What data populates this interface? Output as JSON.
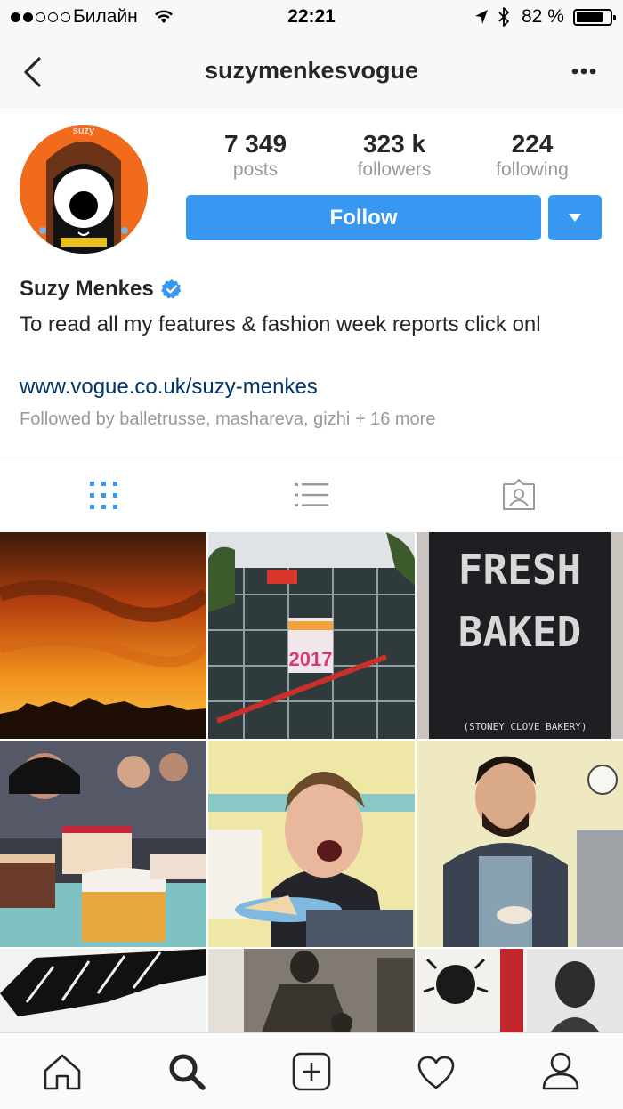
{
  "status_bar": {
    "carrier": "Билайн",
    "time": "22:21",
    "battery": "82 %",
    "battery_level": 0.82
  },
  "nav": {
    "title": "suzymenkesvogue"
  },
  "profile": {
    "avatar_label": "suzy",
    "stats": [
      {
        "value": "7 349",
        "label": "posts"
      },
      {
        "value": "323 k",
        "label": "followers"
      },
      {
        "value": "224",
        "label": "following"
      }
    ],
    "follow_label": "Follow",
    "name": "Suzy Menkes",
    "bio": "To read all my features & fashion week reports click onl",
    "website": "www.vogue.co.uk/suzy-menkes",
    "followed_by": "Followed by balletrusse, mashareva, gizhi + 16 more"
  },
  "tabs": [
    "grid-icon",
    "list-icon",
    "tagged-icon"
  ],
  "posts": [
    {
      "subject": "sunset-sky"
    },
    {
      "subject": "centre-pompidou",
      "text": "2017"
    },
    {
      "subject": "fresh-baked-sign",
      "text_1": "FRESH",
      "text_2": "BAKED",
      "text_3": "(STONEY CLOVE BAKERY)"
    },
    {
      "subject": "cakes-and-crowd"
    },
    {
      "subject": "woman-eating-cake"
    },
    {
      "subject": "baker-with-cake"
    },
    {
      "subject": "black-white-artwork"
    },
    {
      "subject": "vintage-dance-photo"
    },
    {
      "subject": "portrait-artworks"
    }
  ],
  "bottom_nav": [
    "home-icon",
    "search-icon",
    "add-post-icon",
    "activity-heart-icon",
    "profile-icon"
  ],
  "colors": {
    "accent": "#3897f0",
    "link": "#003569",
    "muted": "#999999",
    "verified": "#3897f0"
  }
}
